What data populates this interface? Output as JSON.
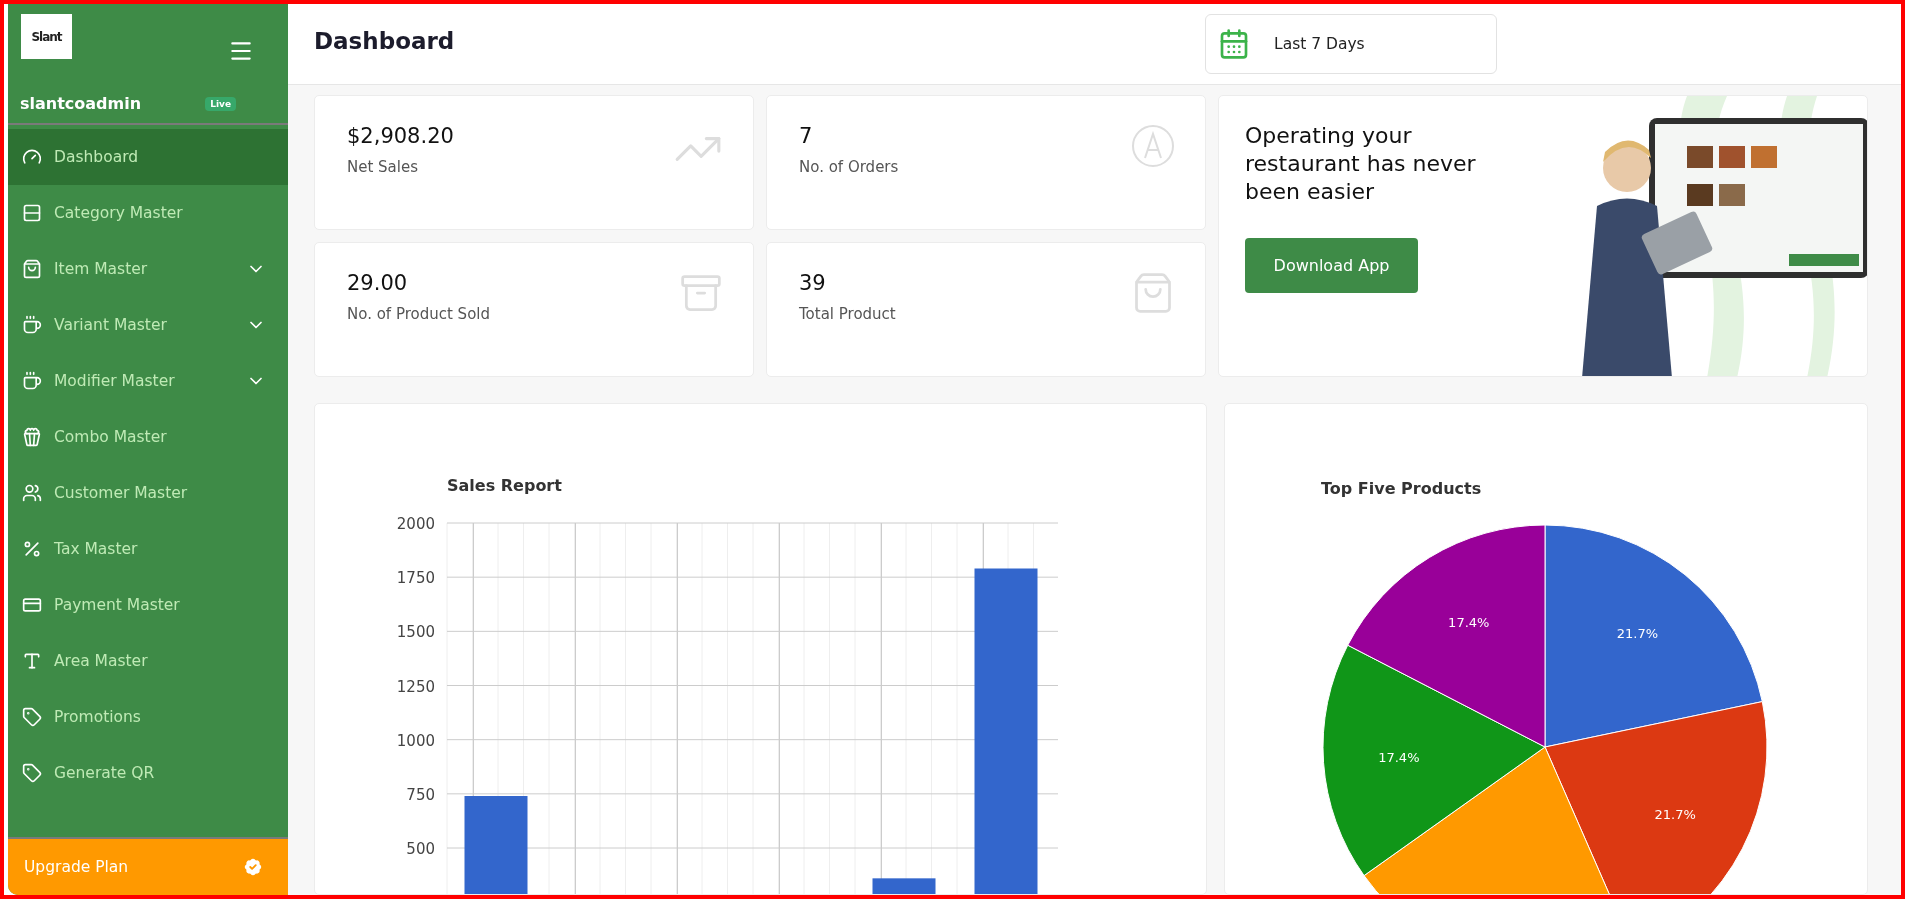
{
  "sidebar": {
    "logo_text": "Slant",
    "user": "slantcoadmin",
    "badge": "Live",
    "items": [
      {
        "label": "Dashboard",
        "selected": true
      },
      {
        "label": "Category Master",
        "selected": false
      },
      {
        "label": "Item Master",
        "selected": false,
        "expanded": false
      },
      {
        "label": "Variant Master",
        "selected": false,
        "expanded": false
      },
      {
        "label": "Modifier Master",
        "selected": false,
        "expanded": false
      },
      {
        "label": "Combo Master",
        "selected": false
      },
      {
        "label": "Customer Master",
        "selected": false
      },
      {
        "label": "Tax Master",
        "selected": false
      },
      {
        "label": "Payment Master",
        "selected": false
      },
      {
        "label": "Area Master",
        "selected": false
      },
      {
        "label": "Promotions",
        "selected": false
      },
      {
        "label": "Generate QR",
        "selected": false
      }
    ],
    "upgrade": "Upgrade Plan"
  },
  "header": {
    "title": "Dashboard",
    "date_range": "Last 7 Days"
  },
  "stats": [
    {
      "value": "$2,908.20",
      "label": "Net Sales"
    },
    {
      "value": "7",
      "label": "No. of Orders"
    },
    {
      "value": "29.00",
      "label": "No. of Product Sold"
    },
    {
      "value": "39",
      "label": "Total Product"
    }
  ],
  "promo": {
    "headline": "Operating your restaurant has never been easier",
    "button": "Download App"
  },
  "sales_report": {
    "chart_data": {
      "type": "bar",
      "title": "Sales Report",
      "values": [
        740,
        0,
        0,
        0,
        360,
        1790
      ],
      "color": "#3366cc",
      "grid": true,
      "ylim": [
        0,
        2000
      ],
      "yticks": [
        500,
        750,
        1000,
        1250,
        1500,
        1750,
        2000
      ]
    }
  },
  "top_products": {
    "chart_data": {
      "type": "pie",
      "title": "Top Five Products",
      "values": [
        21.7,
        21.7,
        21.7,
        17.4,
        17.4
      ],
      "colors": [
        "#3366cc",
        "#dc3912",
        "#ff9900",
        "#109618",
        "#990099"
      ],
      "value_labels": [
        "21.7%",
        "21.7%",
        null,
        "17.4%",
        "17.4%"
      ]
    }
  }
}
